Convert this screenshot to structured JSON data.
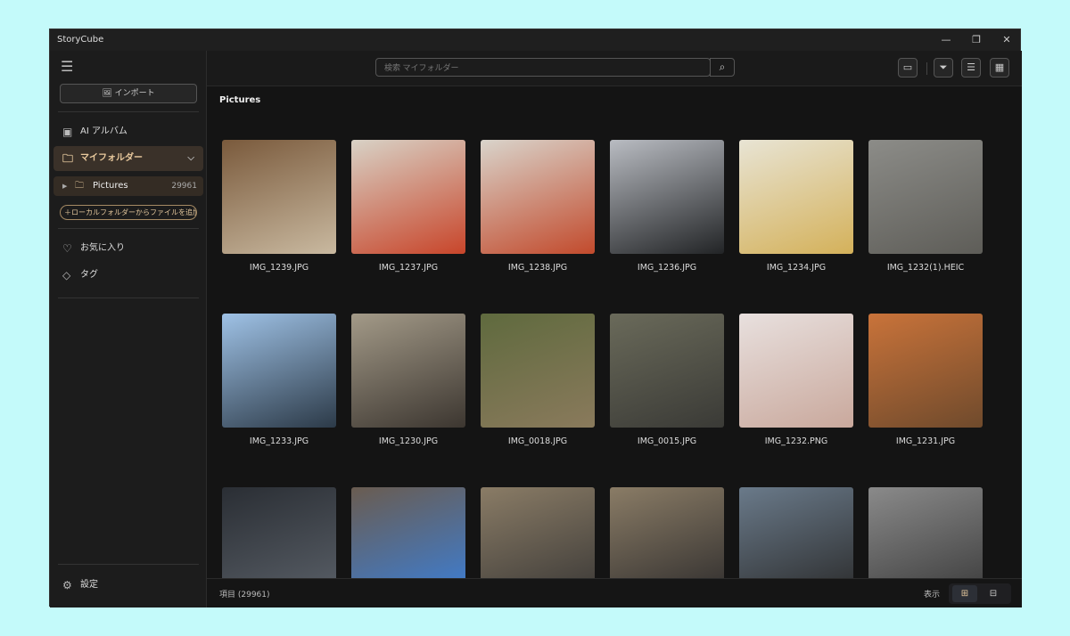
{
  "app": {
    "title": "StoryCube"
  },
  "window_controls": {
    "minimize": "—",
    "restore": "❐",
    "close": "✕"
  },
  "sidebar": {
    "import_label": "インポート",
    "ai_album": "AI アルバム",
    "my_folder": "マイフォルダー",
    "folder": {
      "name": "Pictures",
      "count": "29961"
    },
    "add_folder": "ローカルフォルダーからファイルを追加する",
    "favorites": "お気に入り",
    "tags": "タグ",
    "settings": "設定"
  },
  "search": {
    "placeholder": "検索 マイフォルダー"
  },
  "main": {
    "heading": "Pictures"
  },
  "items": [
    {
      "name": "IMG_1239.JPG",
      "colors": [
        "#7a5a3c",
        "#c9b9a0"
      ]
    },
    {
      "name": "IMG_1237.JPG",
      "colors": [
        "#d8d2c6",
        "#c8452a"
      ]
    },
    {
      "name": "IMG_1238.JPG",
      "colors": [
        "#d9d4cb",
        "#c24a2c"
      ]
    },
    {
      "name": "IMG_1236.JPG",
      "colors": [
        "#b9bcc2",
        "#222426"
      ]
    },
    {
      "name": "IMG_1234.JPG",
      "colors": [
        "#e8e4d4",
        "#d4b15a"
      ]
    },
    {
      "name": "IMG_1232(1).HEIC",
      "colors": [
        "#8c8c88",
        "#5e5d58"
      ]
    },
    {
      "name": "IMG_1233.JPG",
      "colors": [
        "#9fc2e6",
        "#2c3a48"
      ]
    },
    {
      "name": "IMG_1230.JPG",
      "colors": [
        "#a39a88",
        "#3c3630"
      ]
    },
    {
      "name": "IMG_0018.JPG",
      "colors": [
        "#5f6a3e",
        "#8a7a5c"
      ]
    },
    {
      "name": "IMG_0015.JPG",
      "colors": [
        "#6a6a5a",
        "#3a3a36"
      ]
    },
    {
      "name": "IMG_1232.PNG",
      "colors": [
        "#e8e0de",
        "#c9a89c"
      ]
    },
    {
      "name": "IMG_1231.JPG",
      "colors": [
        "#c9733a",
        "#6f4a2c"
      ]
    },
    {
      "name": "",
      "colors": [
        "#2a2e34",
        "#5a6068"
      ]
    },
    {
      "name": "",
      "colors": [
        "#6a5c50",
        "#3b7fd8"
      ]
    },
    {
      "name": "",
      "colors": [
        "#8a7c66",
        "#3a3836"
      ]
    },
    {
      "name": "",
      "colors": [
        "#8a7c66",
        "#2e2c2c"
      ]
    },
    {
      "name": "",
      "colors": [
        "#6a7a8a",
        "#2a2a2a"
      ]
    },
    {
      "name": "",
      "colors": [
        "#8a8a8a",
        "#3a3a3a"
      ]
    }
  ],
  "status": {
    "count": "項目 (29961)",
    "view_label": "表示"
  }
}
